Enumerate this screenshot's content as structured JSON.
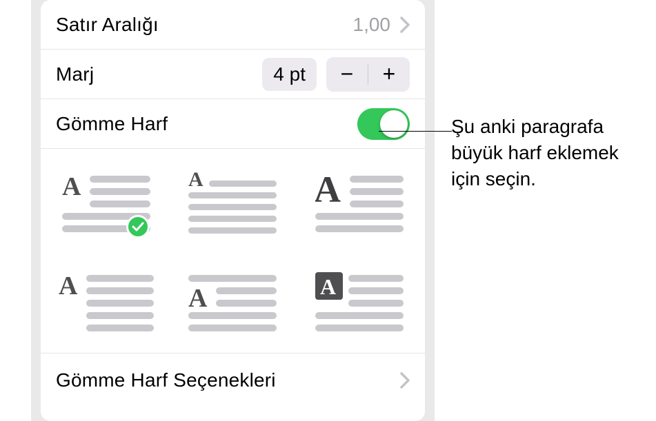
{
  "lineSpacing": {
    "label": "Satır Aralığı",
    "value": "1,00"
  },
  "margin": {
    "label": "Marj",
    "value": "4 pt"
  },
  "dropCap": {
    "label": "Gömme Harf",
    "on": true,
    "selectedIndex": 0
  },
  "dropCapOptions": {
    "label": "Gömme Harf Seçenekleri"
  },
  "callout": {
    "text": "Şu anki paragrafa büyük harf eklemek için seçin."
  },
  "icons": {
    "minus": "−",
    "plus": "+"
  }
}
